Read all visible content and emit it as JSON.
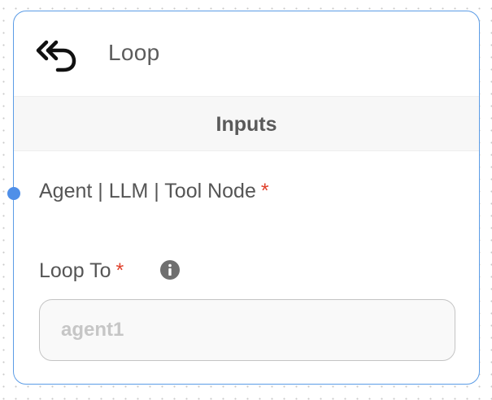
{
  "node": {
    "icon": "loop-back-arrow-icon",
    "title": "Loop",
    "section_title": "Inputs"
  },
  "fields": [
    {
      "label": "Agent | LLM | Tool Node",
      "required_mark": "*"
    },
    {
      "label": "Loop To",
      "required_mark": "*",
      "info_icon": "info-icon",
      "value": "",
      "placeholder": "agent1"
    }
  ],
  "colors": {
    "node_border": "#5b9ce6",
    "handle": "#4f8fe8",
    "required": "#e0402b",
    "section_bg": "#f7f7f7"
  }
}
